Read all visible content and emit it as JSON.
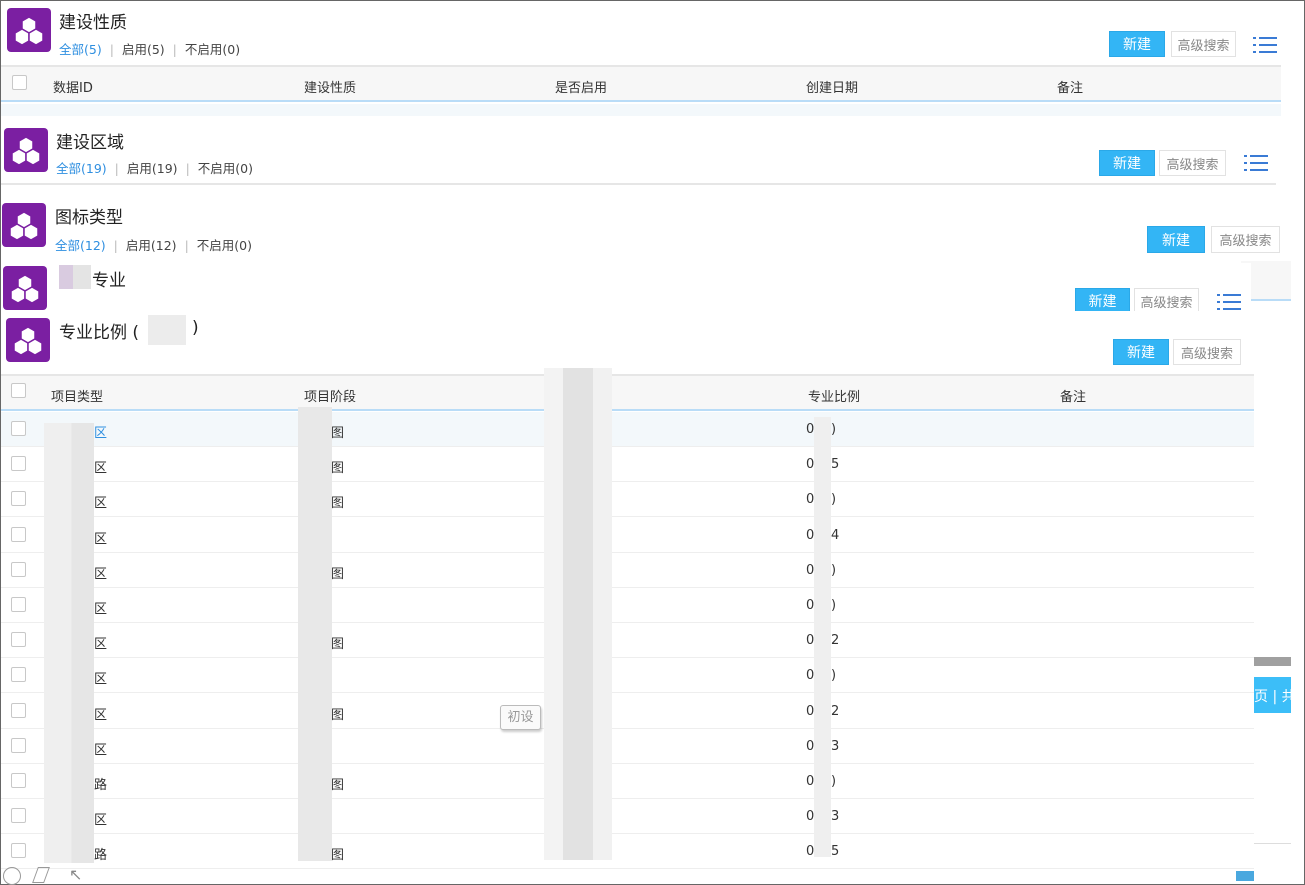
{
  "panels": [
    {
      "title": "建设性质",
      "tabs": [
        "全部(5)",
        "启用(5)",
        "不启用(0)"
      ],
      "new": "新建",
      "adv": "高级搜索",
      "columns": [
        "数据ID",
        "建设性质",
        "是否启用",
        "创建日期",
        "备注"
      ]
    },
    {
      "title": "建设区域",
      "tabs": [
        "全部(19)",
        "启用(19)",
        "不启用(0)"
      ],
      "new": "新建",
      "adv": "高级搜索"
    },
    {
      "title": "图标类型",
      "tabs": [
        "全部(12)",
        "启用(12)",
        "不启用(0)"
      ],
      "new": "新建",
      "adv": "高级搜索"
    },
    {
      "title_suffix": "专业",
      "new": "新建",
      "adv": "高级搜索"
    },
    {
      "title": "专业比例 (",
      "title_close": ")",
      "new": "新建",
      "adv": "高级搜索",
      "columns": [
        "项目类型",
        "项目阶段",
        "专业比例",
        "备注"
      ]
    }
  ],
  "rows": [
    {
      "type": "区",
      "stage": "图",
      "ratio_a": "0",
      "ratio_b": ")"
    },
    {
      "type": "区",
      "stage": "图",
      "ratio_a": "0",
      "ratio_b": "5"
    },
    {
      "type": "区",
      "stage": "图",
      "ratio_a": "0",
      "ratio_b": ")"
    },
    {
      "type": "区",
      "stage": "",
      "ratio_a": "0",
      "ratio_b": "4"
    },
    {
      "type": "区",
      "stage": "图",
      "ratio_a": "0",
      "ratio_b": ")"
    },
    {
      "type": "区",
      "stage": "",
      "ratio_a": "0",
      "ratio_b": ")"
    },
    {
      "type": "区",
      "stage": "图",
      "ratio_a": "0",
      "ratio_b": "2"
    },
    {
      "type": "区",
      "stage": "",
      "ratio_a": "0",
      "ratio_b": ")"
    },
    {
      "type": "区",
      "stage": "图",
      "ratio_a": "0",
      "ratio_b": "2"
    },
    {
      "type": "区",
      "stage": "",
      "ratio_a": "0",
      "ratio_b": "3"
    },
    {
      "type": "路",
      "stage": "图",
      "ratio_a": "0",
      "ratio_b": ")"
    },
    {
      "type": "区",
      "stage": "",
      "ratio_a": "0",
      "ratio_b": "3"
    },
    {
      "type": "路",
      "stage": "图",
      "ratio_a": "0",
      "ratio_b": "5"
    }
  ],
  "tooltip": "初设",
  "pagination": "页 | 共",
  "colors": {
    "accent": "#33b5f5",
    "logo": "#7b1fa2",
    "link": "#2f8fe0"
  }
}
